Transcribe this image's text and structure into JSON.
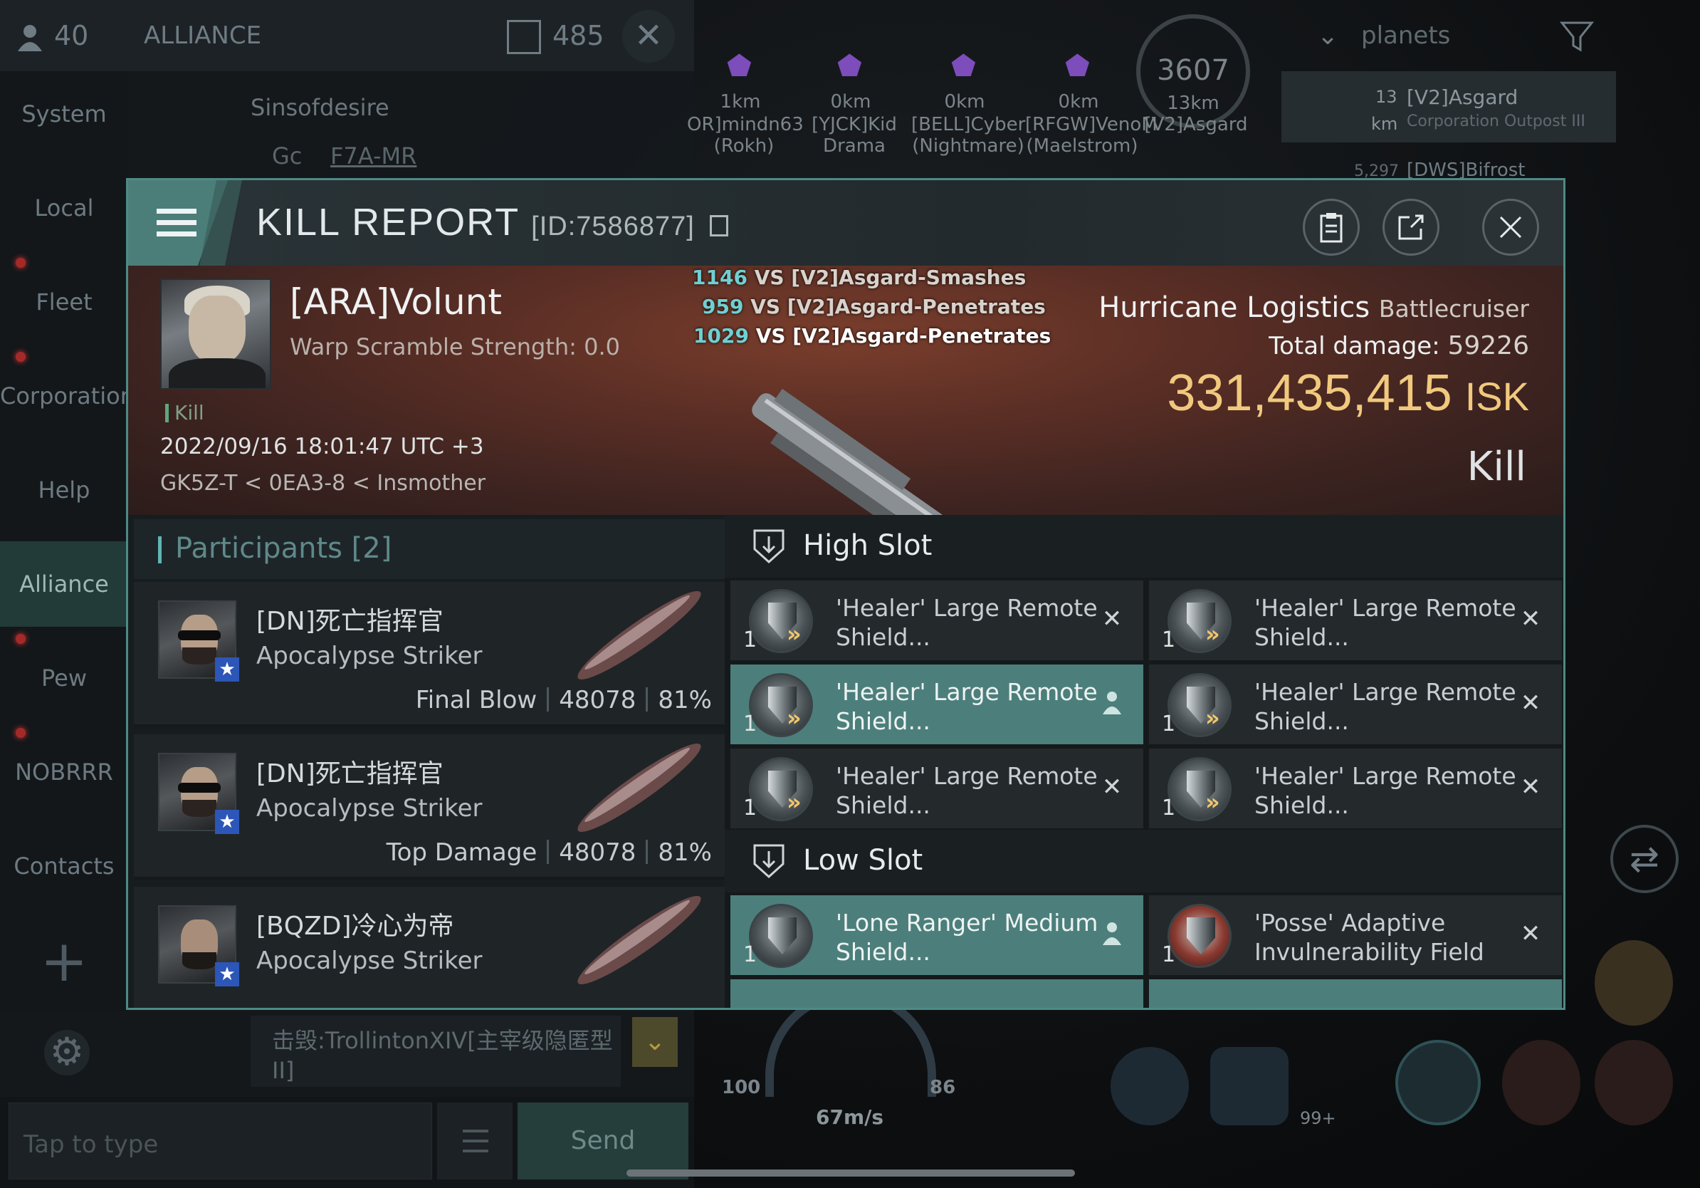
{
  "background": {
    "chat": {
      "member_count": "40",
      "channel_title": "ALLIANCE",
      "message_count": "485",
      "sender_name": "Sinsofdesire",
      "sender_prefix": "Gc",
      "sender_location": "F7A-MR",
      "last_message": "击毁:TrollintonXIV[主宰级隐匿型II]",
      "input_placeholder": "Tap to type",
      "send_label": "Send"
    },
    "nav_items": [
      "System",
      "Local",
      "Fleet",
      "Corporation",
      "Help",
      "Alliance",
      "Pew",
      "NOBRRR",
      "Contacts"
    ],
    "hud": {
      "speed_display": "3607",
      "speed_km": "13km",
      "targets": [
        {
          "dist": "1km",
          "name": "OR]mindn63\n(Rokh)"
        },
        {
          "dist": "0km",
          "name": "[YJCK]Kid\nDrama"
        },
        {
          "dist": "0km",
          "name": "[BELL]Cyber\n(Nightmare)"
        },
        {
          "dist": "0km",
          "name": "[RFGW]VenoM\n(Maelstrom)"
        }
      ],
      "target_extra": "[V2]Asgard",
      "filter_label": "planets",
      "overview_row1": {
        "dist": "13",
        "unit": "km",
        "name": "[V2]Asgard",
        "sub": "Corporation Outpost III"
      },
      "overview_row2": {
        "dist": "5,297",
        "name": "[DWS]Bifrost"
      },
      "capacitor_left": "100",
      "capacitor_right": "86",
      "velocity": "67m/s",
      "badge": "99+"
    }
  },
  "modal": {
    "title": "KILL REPORT",
    "report_id": "[ID:7586877]",
    "victim": {
      "name": "[ARA]Volunt",
      "warp_scramble": "Warp Scramble Strength: 0.0",
      "type_tag": "Kill",
      "datetime": "2022/09/16 18:01:47 UTC +3",
      "location": "GK5Z-T < 0EA3-8 < Insmother"
    },
    "combat_log": [
      {
        "value": "1146",
        "text": "VS [V2]Asgard-Smashes"
      },
      {
        "value": "959",
        "text": "VS [V2]Asgard-Penetrates"
      },
      {
        "value": "1029",
        "text": "VS [V2]Asgard-Penetrates"
      }
    ],
    "ship": {
      "name": "Hurricane Logistics",
      "class": "Battlecruiser",
      "damage_label": "Total damage:",
      "damage_value": "59226",
      "isk_value": "331,435,415",
      "isk_unit": "ISK",
      "result": "Kill"
    },
    "participants": {
      "label": "Participants [2]",
      "rows": [
        {
          "name": "[DN]死亡指挥官",
          "ship": "Apocalypse Striker",
          "role": "Final Blow",
          "damage": "48078",
          "percent": "81%"
        },
        {
          "name": "[DN]死亡指挥官",
          "ship": "Apocalypse Striker",
          "role": "Top Damage",
          "damage": "48078",
          "percent": "81%"
        },
        {
          "name": "[BQZD]冷心为帝",
          "ship": "Apocalypse Striker",
          "role": "",
          "damage": "",
          "percent": ""
        }
      ]
    },
    "high_slot": {
      "label": "High Slot",
      "items": [
        {
          "qty": "1",
          "name": "'Healer' Large Remote Shield...",
          "status": "destroyed"
        },
        {
          "qty": "1",
          "name": "'Healer' Large Remote Shield...",
          "status": "destroyed"
        },
        {
          "qty": "1",
          "name": "'Healer' Large Remote Shield...",
          "status": "dropped"
        },
        {
          "qty": "1",
          "name": "'Healer' Large Remote Shield...",
          "status": "destroyed"
        },
        {
          "qty": "1",
          "name": "'Healer' Large Remote Shield...",
          "status": "destroyed"
        },
        {
          "qty": "1",
          "name": "'Healer' Large Remote Shield...",
          "status": "destroyed"
        }
      ]
    },
    "low_slot": {
      "label": "Low Slot",
      "items": [
        {
          "qty": "1",
          "name": "'Lone Ranger' Medium Shield...",
          "status": "dropped"
        },
        {
          "qty": "1",
          "name": "'Posse' Adaptive Invulnerability Field",
          "status": "destroyed"
        }
      ]
    }
  },
  "colors": {
    "accent_teal": "#4c7f7b",
    "isk_gold": "#f1c97e",
    "hero_red": "#5a2e25",
    "combat_number": "#6fd0d3"
  }
}
